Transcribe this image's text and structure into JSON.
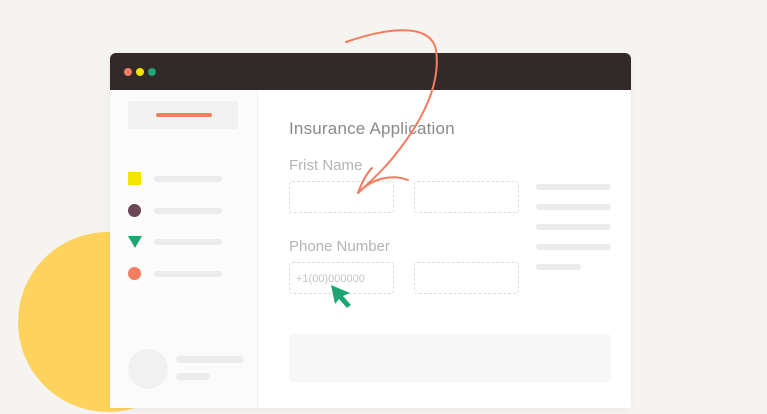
{
  "form": {
    "title": "Insurance Application",
    "first_name_label": "Frist Name",
    "phone_label": "Phone Number",
    "phone_placeholder": "+1(00)000000"
  },
  "colors": {
    "accent": "#f47c5f",
    "titlebar": "#322a28",
    "blob": "#fdd35e",
    "cursor": "#1ea672",
    "window_dots": [
      "#f47c5f",
      "#f5e400",
      "#1ea672"
    ]
  },
  "sidebar": {
    "items": [
      {
        "icon": "yellow-square-icon",
        "color": "#f5e400"
      },
      {
        "icon": "purple-circle-icon",
        "color": "#6b4655"
      },
      {
        "icon": "green-triangle-icon",
        "color": "#1ea672"
      },
      {
        "icon": "orange-circle-icon",
        "color": "#f47c5f"
      }
    ]
  },
  "icons": {
    "arrow": "curved-arrow-icon",
    "cursor": "mouse-pointer-icon"
  }
}
